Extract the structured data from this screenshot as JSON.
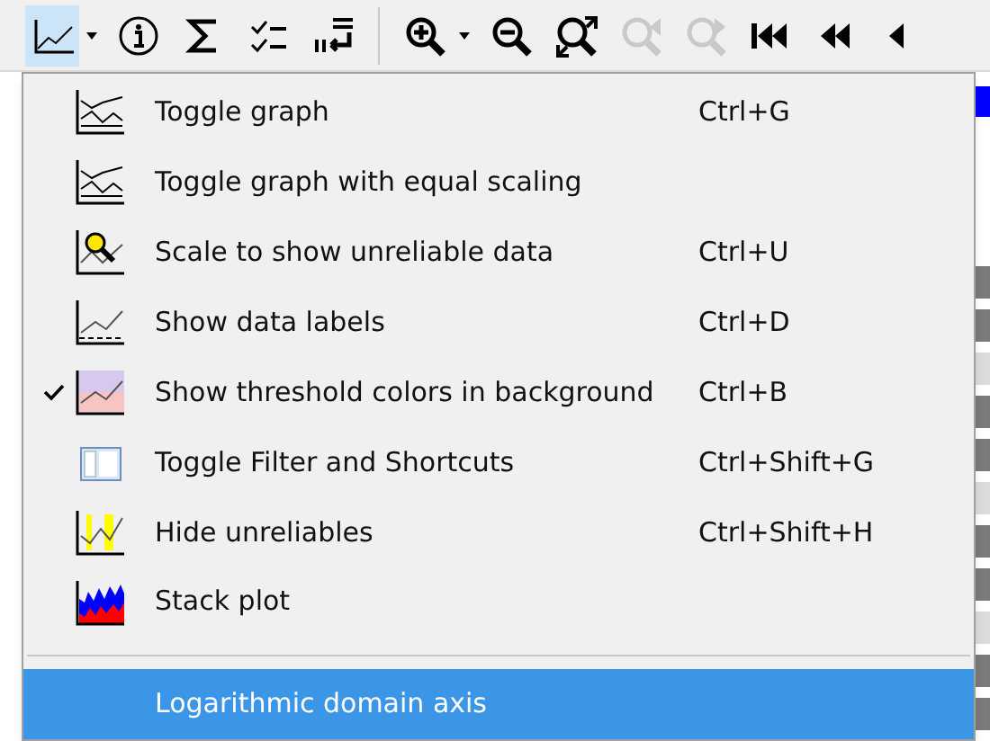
{
  "toolbar": {
    "items": [
      {
        "kind": "chart",
        "selected": true
      },
      {
        "kind": "caret",
        "selected": false
      },
      {
        "kind": "info",
        "selected": false
      },
      {
        "kind": "sigma",
        "selected": false
      },
      {
        "kind": "checklist",
        "selected": false
      },
      {
        "kind": "sort",
        "selected": false
      },
      {
        "kind": "separator"
      },
      {
        "kind": "zoom-in",
        "selected": false
      },
      {
        "kind": "caret",
        "selected": false
      },
      {
        "kind": "zoom-out",
        "selected": false
      },
      {
        "kind": "zoom-fit",
        "selected": false
      },
      {
        "kind": "zoom-back",
        "selected": false,
        "disabled": true
      },
      {
        "kind": "zoom-forward",
        "selected": false,
        "disabled": true
      },
      {
        "kind": "first",
        "selected": false
      },
      {
        "kind": "prev",
        "selected": false
      },
      {
        "kind": "step",
        "selected": false
      }
    ]
  },
  "menu": {
    "items": [
      {
        "label": "Toggle graph",
        "shortcut": "Ctrl+G",
        "checked": false,
        "selected": false
      },
      {
        "label": "Toggle graph with equal scaling",
        "checked": false,
        "selected": false
      },
      {
        "label": "Scale to show unreliable data",
        "shortcut": "Ctrl+U",
        "checked": false,
        "selected": false
      },
      {
        "label": "Show data labels",
        "shortcut": "Ctrl+D",
        "checked": false,
        "selected": false
      },
      {
        "label": "Show threshold colors  in background",
        "shortcut": "Ctrl+B",
        "checked": true,
        "selected": false
      },
      {
        "label": "Toggle Filter and Shortcuts",
        "shortcut": "Ctrl+Shift+G",
        "checked": false,
        "selected": false
      },
      {
        "label": "Hide unreliables",
        "shortcut": "Ctrl+Shift+H",
        "checked": false,
        "selected": false
      },
      {
        "label": "Stack plot",
        "checked": false,
        "selected": false
      },
      {
        "kind": "separator"
      },
      {
        "label": "Logarithmic domain axis",
        "checked": false,
        "selected": true
      }
    ]
  }
}
